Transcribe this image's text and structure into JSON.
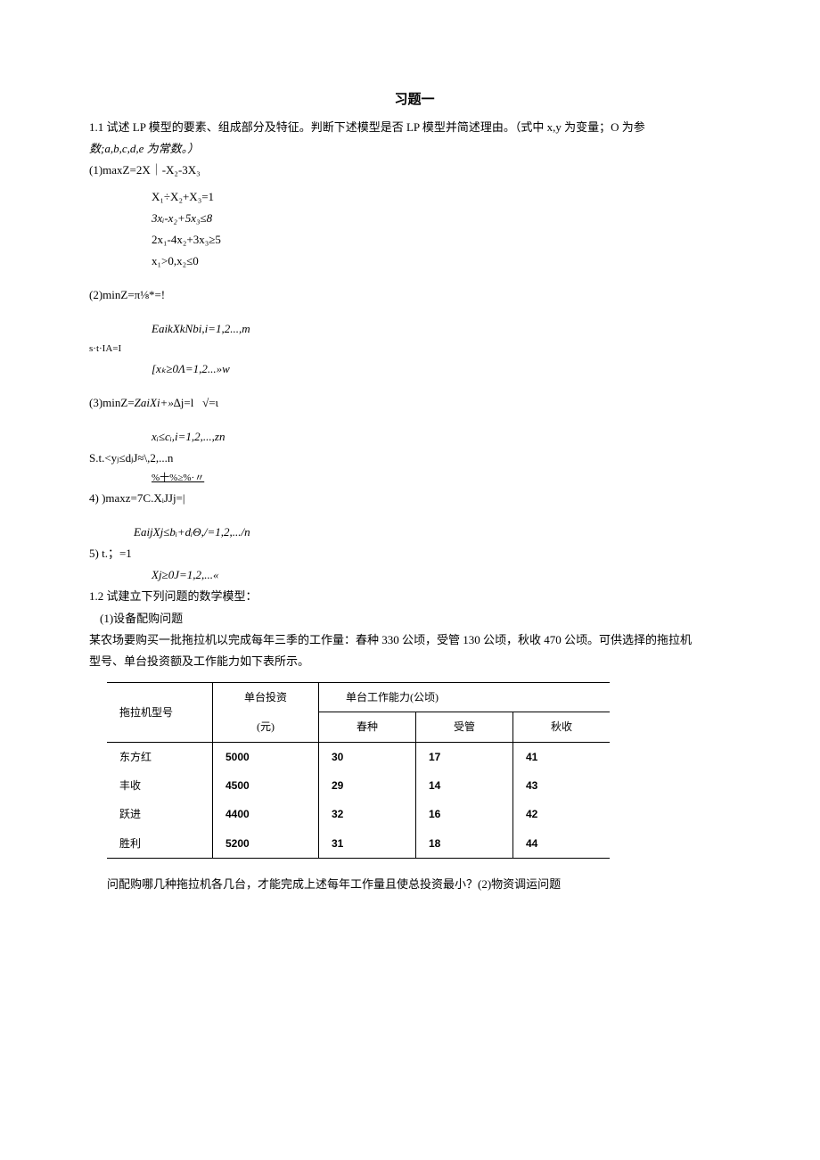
{
  "title": "习题一",
  "p1_1": "1.1 试述 LP 模型的要素、组成部分及特征。判断下述模型是否 LP 模型并简述理由。（式中 x,y 为变量；O 为参",
  "p1_2": "数;a,b,c,d,e 为常数。）",
  "eq1_head": "(1)maxZ=2X｜-X₂-3X₃",
  "eq1_l1": "X₁÷X₂+X₃=1",
  "eq1_l2": "3xᵢ-x₂+5x₃≤8",
  "eq1_l3": "2x₁-4x₂+3x₃≥5",
  "eq1_l4": "x₁>0,x₂≤0",
  "eq2_head": "(2)minZ=π⅛*=!",
  "eq2_l1": "EaikXkNbi,i=1,2...,m",
  "eq2_st": "s·t·IA=I",
  "eq2_l2": "[xₖ≥0Λ=1,2...»w",
  "eq3_head": "(3)minZ=ZaiXi+»∆j=l   √=ι",
  "eq3_l1": "xᵢ≤cᵢ,i=1,2,...,zn",
  "eq3_st": "S.t.<yⱼ≤dⱼJ≈\\,2,...n",
  "eq3_l2": "%十%≥%·〃",
  "eq4_head": "4)   )maxz=7C.XᵢJJj=|",
  "eq4_l1": "EaijXj≤bᵢ+dᵢΘ,/=1,2,.../n",
  "eq5_head": "5)   t.；=1",
  "eq5_l1": "Xj≥0J=1,2,...«",
  "p2": "1.2 试建立下列问题的数学模型：",
  "p2_1": "(1)设备配购问题",
  "p2_2": "某农场要购买一批拖拉机以完成每年三季的工作量：春种 330 公顷，受管 130 公顷，秋收 470 公顷。可供选择的拖拉机",
  "p2_3": "型号、单台投资额及工作能力如下表所示。",
  "table": {
    "h1": "拖拉机型号",
    "h2": "单台投资",
    "h2b": "(元)",
    "h3": "单台工作能力(公顷)",
    "h3a": "春种",
    "h3b": "受管",
    "h3c": "秋收",
    "rows": [
      {
        "m": "东方红",
        "inv": "5000",
        "a": "30",
        "b": "17",
        "c": "41"
      },
      {
        "m": "丰收",
        "inv": "4500",
        "a": "29",
        "b": "14",
        "c": "43"
      },
      {
        "m": "跃进",
        "inv": "4400",
        "a": "32",
        "b": "16",
        "c": "42"
      },
      {
        "m": "胜利",
        "inv": "5200",
        "a": "31",
        "b": "18",
        "c": "44"
      }
    ]
  },
  "p3": "问配购哪几种拖拉机各几台，才能完成上述每年工作量且使总投资最小？(2)物资调运问题"
}
